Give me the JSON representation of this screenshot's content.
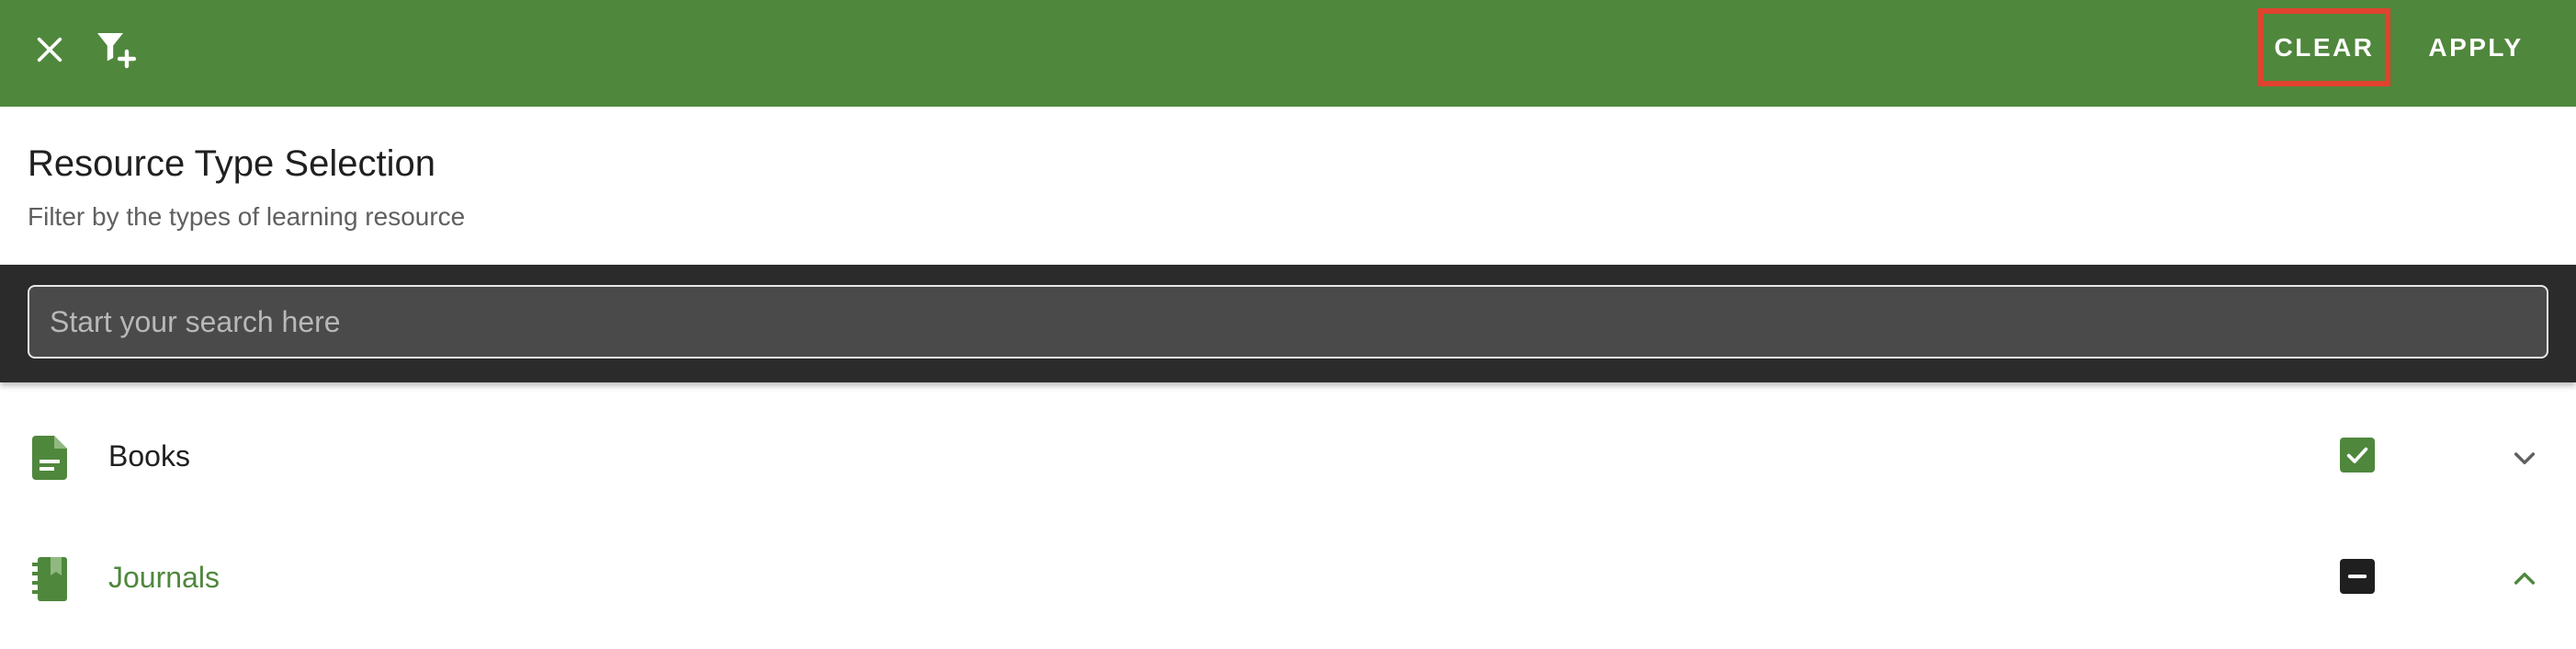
{
  "toolbar": {
    "close_icon": "close-icon",
    "filter_icon": "filter-add-icon",
    "clear_label": "CLEAR",
    "apply_label": "APPLY",
    "bar_color": "#4f873c",
    "highlight_color": "#e0422f"
  },
  "header": {
    "title": "Resource Type Selection",
    "subtitle": "Filter by the types of learning resource"
  },
  "search": {
    "placeholder": "Start your search here",
    "value": ""
  },
  "items": [
    {
      "label": "Books",
      "icon": "document-icon",
      "check_state": "checked",
      "expanded": false,
      "chevron_icon": "chevron-down-icon"
    },
    {
      "label": "Journals",
      "icon": "journal-icon",
      "check_state": "indeterminate",
      "expanded": true,
      "chevron_icon": "chevron-up-icon"
    }
  ]
}
